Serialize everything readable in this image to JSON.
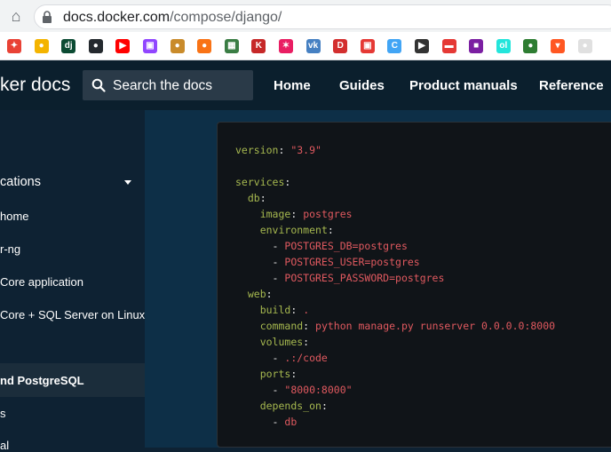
{
  "browser": {
    "url_host": "docs.docker.com",
    "url_path": "/compose/django/",
    "bookmarks": [
      {
        "icon": "pinwheel-icon",
        "color": "#e94235",
        "glyph": "✦"
      },
      {
        "icon": "bulb-icon",
        "color": "#f4b400",
        "glyph": "●"
      },
      {
        "icon": "django-icon",
        "color": "#0c4b33",
        "glyph": "dj"
      },
      {
        "icon": "github-icon",
        "color": "#24292e",
        "glyph": "●"
      },
      {
        "icon": "youtube-icon",
        "color": "#ff0000",
        "glyph": "▶"
      },
      {
        "icon": "twitch-icon",
        "color": "#9146ff",
        "glyph": "▣"
      },
      {
        "icon": "hat-icon",
        "color": "#c98b2b",
        "glyph": "●"
      },
      {
        "icon": "orange-icon",
        "color": "#f97316",
        "glyph": "●"
      },
      {
        "icon": "picture-icon",
        "color": "#3a7d44",
        "glyph": "▦"
      },
      {
        "icon": "k-icon",
        "color": "#c62828",
        "glyph": "K"
      },
      {
        "icon": "star-icon",
        "color": "#e91e63",
        "glyph": "✶"
      },
      {
        "icon": "vk-icon",
        "color": "#4680c2",
        "glyph": "vk"
      },
      {
        "icon": "d-icon",
        "color": "#d32f2f",
        "glyph": "D"
      },
      {
        "icon": "tv-icon",
        "color": "#e53935",
        "glyph": "▣"
      },
      {
        "icon": "c-icon",
        "color": "#42a5f5",
        "glyph": "C"
      },
      {
        "icon": "play-icon",
        "color": "#333333",
        "glyph": "▶"
      },
      {
        "icon": "car-icon",
        "color": "#e53935",
        "glyph": "▬"
      },
      {
        "icon": "square-icon",
        "color": "#7b1fa2",
        "glyph": "■"
      },
      {
        "icon": "olx-icon",
        "color": "#23e5db",
        "glyph": "ol"
      },
      {
        "icon": "bird-icon",
        "color": "#2e7d32",
        "glyph": "●"
      },
      {
        "icon": "shop-icon",
        "color": "#ff5722",
        "glyph": "▾"
      },
      {
        "icon": "info-icon",
        "color": "#e0e0e0",
        "glyph": "●"
      }
    ]
  },
  "header": {
    "brand": "ker docs",
    "search_placeholder": "Search the docs",
    "nav": [
      "Home",
      "Guides",
      "Product manuals",
      "Reference"
    ]
  },
  "sidebar": {
    "section": "cations",
    "items": [
      "home",
      "r-ng",
      "Core application",
      "Core + SQL Server on Linux"
    ],
    "active": "nd PostgreSQL",
    "after": [
      "s",
      "al"
    ]
  },
  "code": {
    "version_key": "version",
    "version_val": "\"3.9\"",
    "services": "services",
    "db": "db",
    "image_key": "image",
    "image_val": "postgres",
    "environment": "environment",
    "env": [
      "POSTGRES_DB=postgres",
      "POSTGRES_USER=postgres",
      "POSTGRES_PASSWORD=postgres"
    ],
    "web": "web",
    "build_key": "build",
    "build_val": ".",
    "command_key": "command",
    "command_val": "python manage.py runserver 0.0.0.0:8000",
    "volumes": "volumes",
    "volume": ".:/code",
    "ports": "ports",
    "port": "\"8000:8000\"",
    "depends_on": "depends_on",
    "depends": "db"
  },
  "colors": {
    "header_bg": "#0b1f2d",
    "main_bg": "#0d2f47",
    "code_bg": "#101418",
    "yaml_key": "#a6b84f",
    "yaml_string": "#e0595f"
  }
}
